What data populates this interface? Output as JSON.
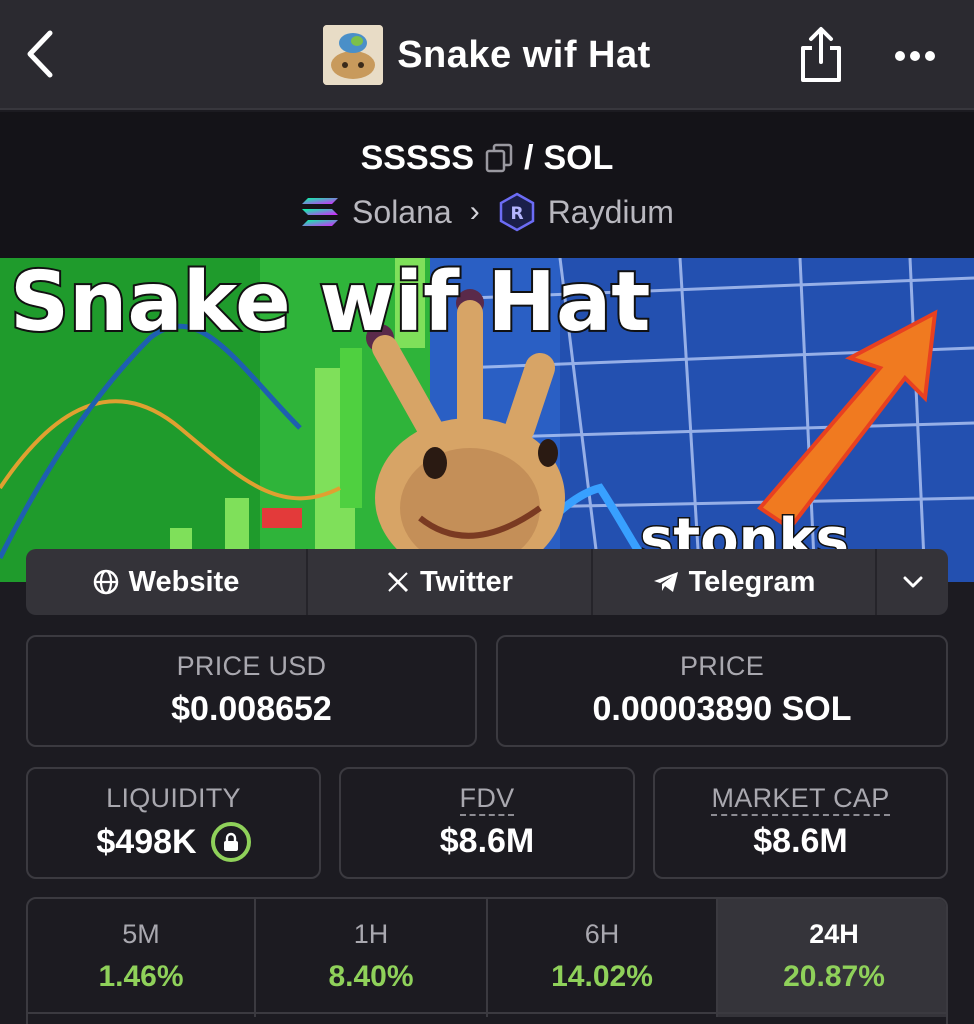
{
  "header": {
    "title": "Snake wif Hat"
  },
  "pair": {
    "base": "SSSSS",
    "separator": "/",
    "quote": "SOL",
    "chain": "Solana",
    "dex": "Raydium"
  },
  "banner": {
    "headline": "Snake wif Hat",
    "caption": "stonks"
  },
  "links": {
    "website": "Website",
    "twitter": "Twitter",
    "telegram": "Telegram"
  },
  "stats": {
    "price_usd_label": "PRICE USD",
    "price_usd_value": "$0.008652",
    "price_label": "PRICE",
    "price_value": "0.00003890 SOL",
    "liquidity_label": "LIQUIDITY",
    "liquidity_value": "$498K",
    "fdv_label": "FDV",
    "fdv_value": "$8.6M",
    "mcap_label": "MARKET CAP",
    "mcap_value": "$8.6M"
  },
  "changes": [
    {
      "period": "5M",
      "pct": "1.46%"
    },
    {
      "period": "1H",
      "pct": "8.40%"
    },
    {
      "period": "6H",
      "pct": "14.02%"
    },
    {
      "period": "24H",
      "pct": "20.87%",
      "selected": true
    }
  ],
  "colors": {
    "positive": "#8fd15a",
    "background": "#1c1b21",
    "topbar": "#2b2a30"
  },
  "icons": [
    "back-arrow-icon",
    "share-icon",
    "more-icon",
    "copy-icon",
    "solana-icon",
    "raydium-icon",
    "globe-icon",
    "x-icon",
    "telegram-icon",
    "chevron-down-icon",
    "lock-icon"
  ]
}
